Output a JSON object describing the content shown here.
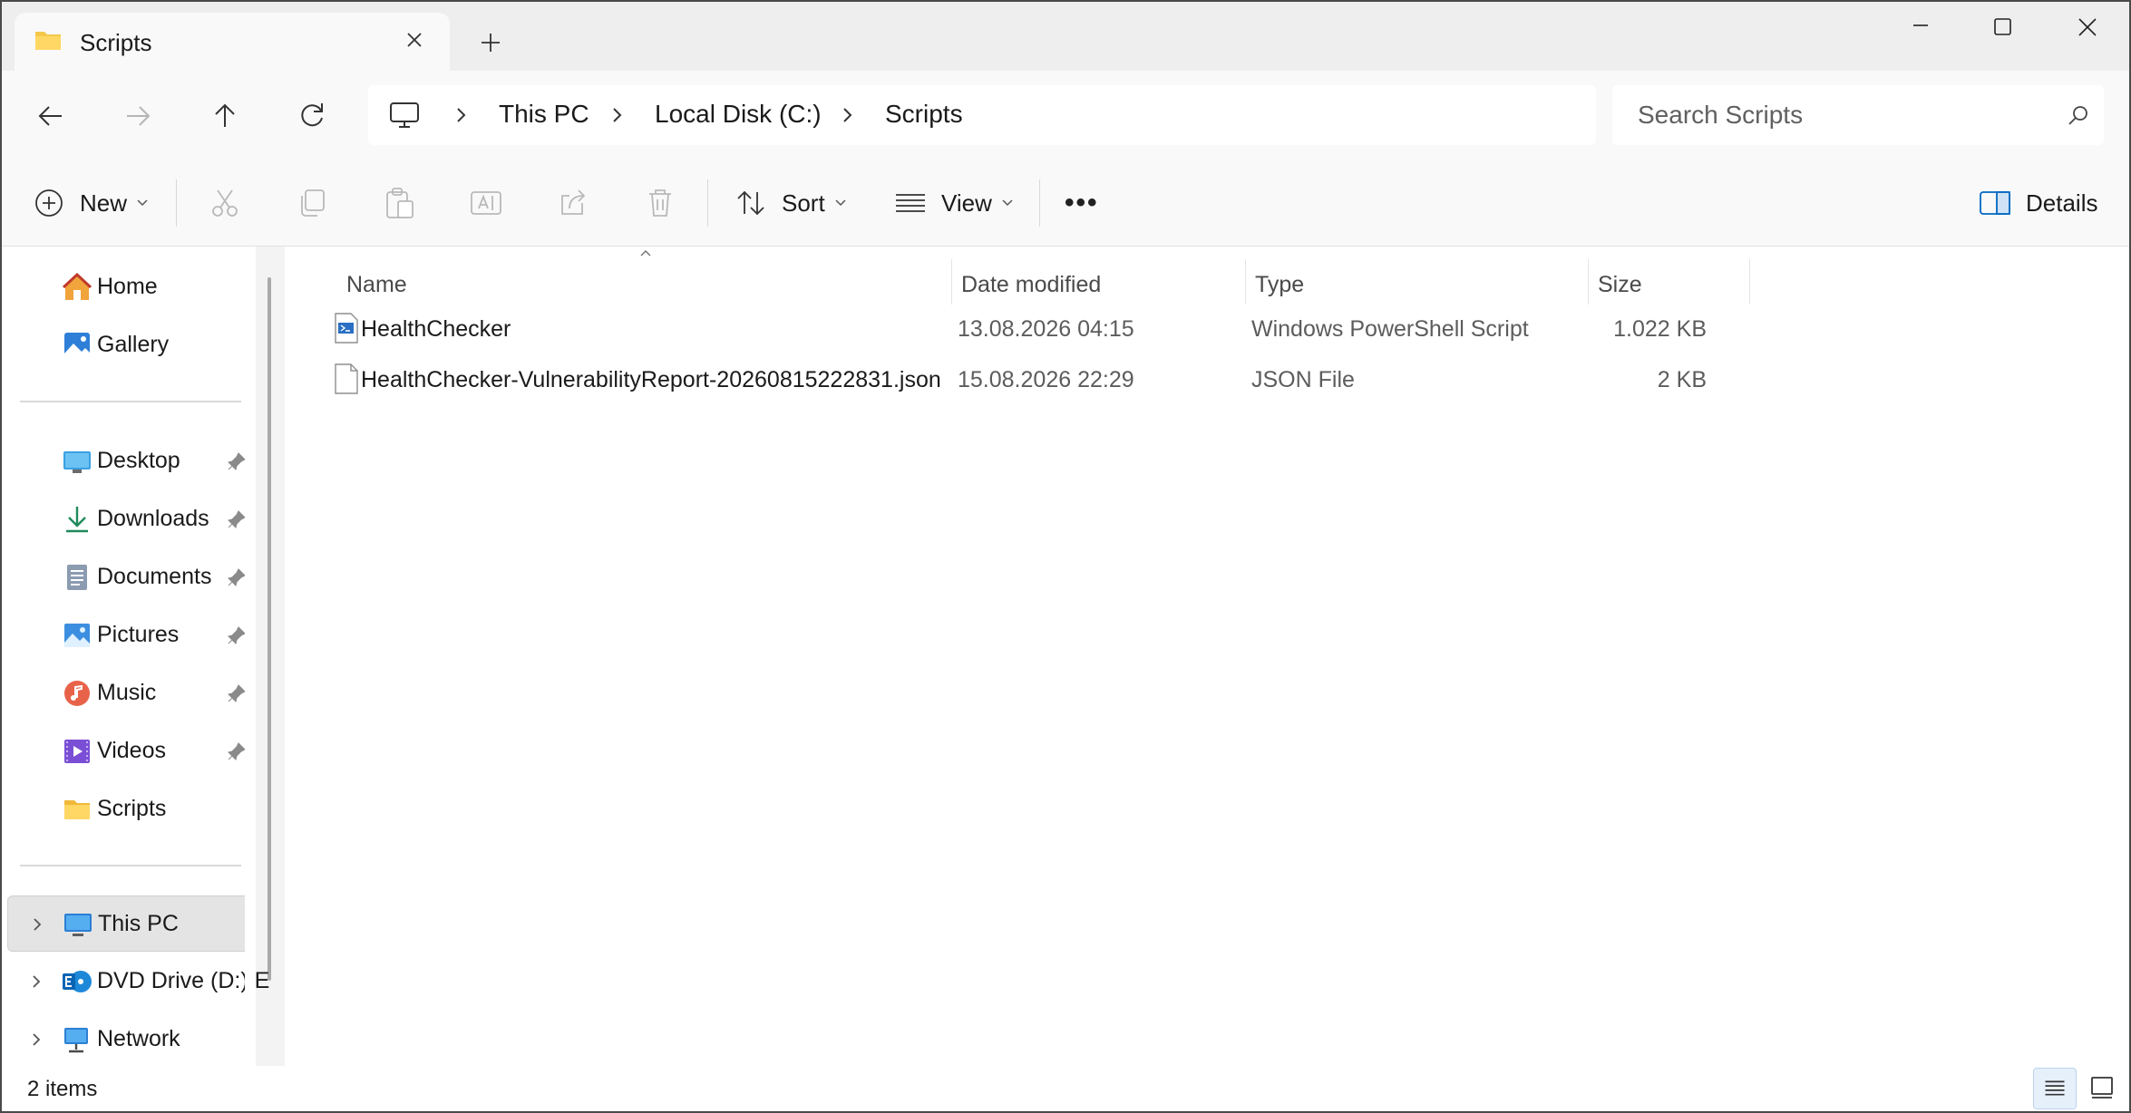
{
  "window": {
    "tab_title": "Scripts",
    "tab_icon": "folder-icon",
    "new_tab_icon": "plus-icon",
    "minimize_icon": "minimize-icon",
    "maximize_icon": "maximize-icon",
    "close_icon": "close-icon"
  },
  "nav": {
    "back_icon": "arrow-left-icon",
    "forward_icon": "arrow-right-icon",
    "up_icon": "arrow-up-icon",
    "refresh_icon": "refresh-icon",
    "breadcrumb": [
      "This PC",
      "Local Disk (C:)",
      "Scripts"
    ],
    "search_placeholder": "Search Scripts"
  },
  "toolbar": {
    "new_label": "New",
    "sort_label": "Sort",
    "view_label": "View",
    "more_label": "•••",
    "details_label": "Details",
    "icons": [
      "cut-icon",
      "copy-icon",
      "paste-icon",
      "rename-icon",
      "share-icon",
      "delete-icon"
    ]
  },
  "sidebar": {
    "quick": [
      {
        "label": "Home",
        "icon": "home-icon"
      },
      {
        "label": "Gallery",
        "icon": "gallery-icon"
      }
    ],
    "pinned": [
      {
        "label": "Desktop",
        "icon": "desktop-icon",
        "pinned": true
      },
      {
        "label": "Downloads",
        "icon": "download-icon",
        "pinned": true
      },
      {
        "label": "Documents",
        "icon": "documents-icon",
        "pinned": true
      },
      {
        "label": "Pictures",
        "icon": "pictures-icon",
        "pinned": true
      },
      {
        "label": "Music",
        "icon": "music-icon",
        "pinned": true
      },
      {
        "label": "Videos",
        "icon": "videos-icon",
        "pinned": true
      },
      {
        "label": "Scripts",
        "icon": "folder-icon",
        "pinned": false
      }
    ],
    "drives": [
      {
        "label": "This PC",
        "icon": "computer-icon",
        "selected": true
      },
      {
        "label": "DVD Drive (D:) E",
        "icon": "dvd-drive-icon",
        "selected": false
      },
      {
        "label": "Network",
        "icon": "network-icon",
        "selected": false
      }
    ]
  },
  "files": {
    "columns": {
      "name": "Name",
      "date": "Date modified",
      "type": "Type",
      "size": "Size"
    },
    "rows": [
      {
        "name": "HealthChecker",
        "date": "13.08.2026 04:15",
        "type": "Windows PowerShell Script",
        "size": "1.022 KB",
        "icon": "powershell-script-icon"
      },
      {
        "name": "HealthChecker-VulnerabilityReport-20260815222831.json",
        "date": "15.08.2026 22:29",
        "type": "JSON File",
        "size": "2 KB",
        "icon": "file-icon"
      }
    ]
  },
  "status": {
    "item_count": "2 items",
    "details_view_icon": "details-view-icon",
    "tiles_view_icon": "large-icons-view-icon"
  },
  "colors": {
    "accent": "#0067c0",
    "folder": "#f4c84a",
    "selection": "#e4e4e4"
  }
}
